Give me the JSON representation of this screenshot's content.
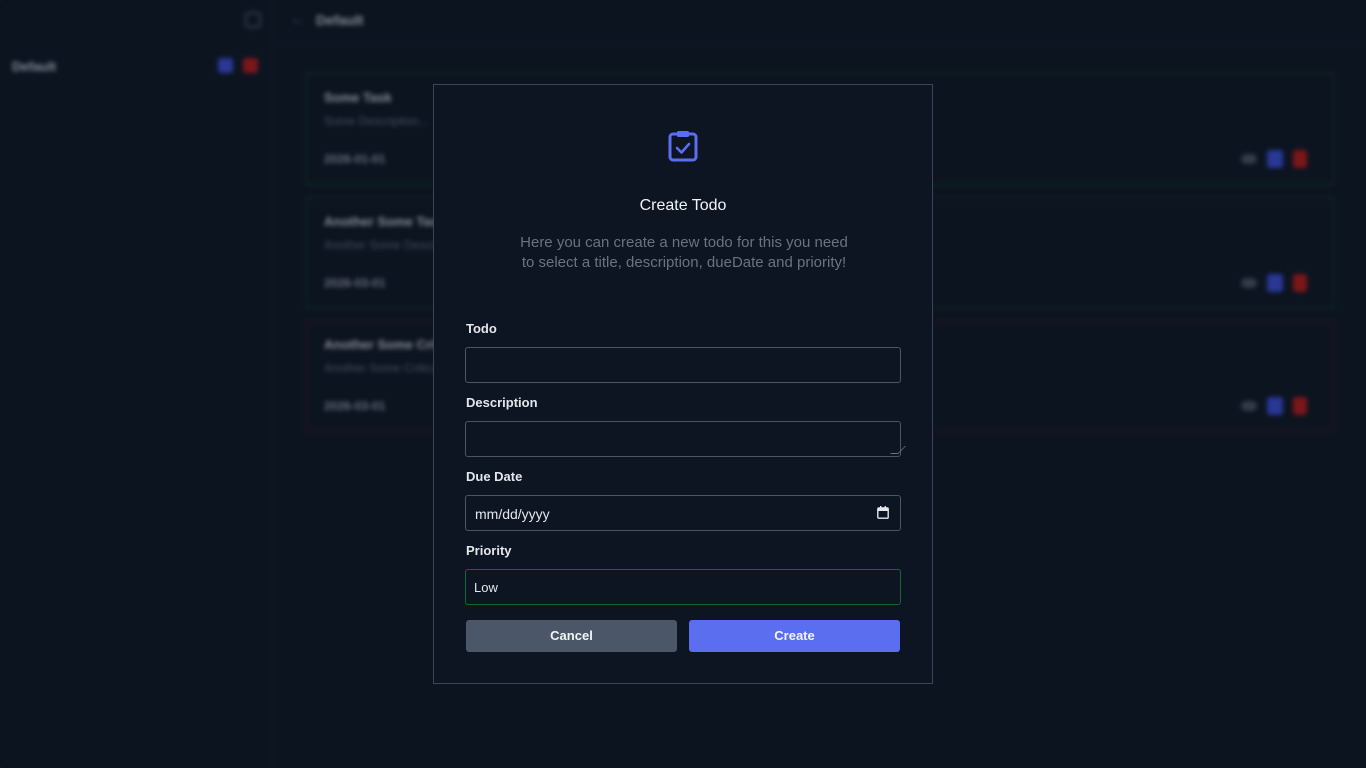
{
  "sidebar": {
    "project_name": "Default"
  },
  "header": {
    "title": "Default"
  },
  "todos": [
    {
      "title": "Some Task",
      "description": "Some Description...",
      "date": "2026-01-01",
      "priority_color": "#14532d"
    },
    {
      "title": "Another Some Task",
      "description": "Another Some Description",
      "date": "2026-03-01",
      "priority_color": "#14532d"
    },
    {
      "title": "Another Some Critical",
      "description": "Another Some Critical Description",
      "date": "2026-03-01",
      "priority_color": "#5a1e25"
    }
  ],
  "modal": {
    "icon": "clipboard-check-icon",
    "title": "Create Todo",
    "subtitle": "Here you can create a new todo for this you need to select a title, description, dueDate and priority!",
    "fields": {
      "todo_label": "Todo",
      "todo_value": "",
      "description_label": "Description",
      "description_value": "",
      "due_date_label": "Due Date",
      "due_date_placeholder": "mm/dd/yyyy",
      "priority_label": "Priority",
      "priority_value": "Low"
    },
    "buttons": {
      "cancel": "Cancel",
      "create": "Create"
    }
  },
  "colors": {
    "accent": "#5b6ef0",
    "background": "#0f1726",
    "modal_background": "#0d1422",
    "low_priority": "#166534",
    "danger": "#b91c1c"
  }
}
